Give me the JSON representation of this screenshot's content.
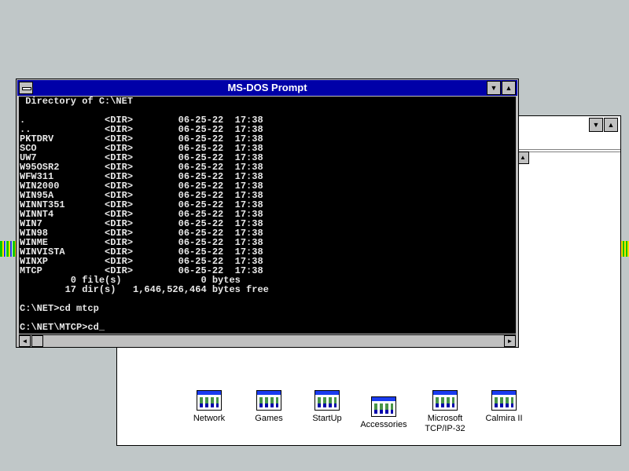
{
  "dos_window": {
    "title": "MS-DOS Prompt",
    "lines": [
      " Directory of C:\\NET",
      "",
      ".              <DIR>        06-25-22  17:38",
      "..             <DIR>        06-25-22  17:38",
      "PKTDRV         <DIR>        06-25-22  17:38",
      "SCO            <DIR>        06-25-22  17:38",
      "UW7            <DIR>        06-25-22  17:38",
      "W95OSR2        <DIR>        06-25-22  17:38",
      "WFW311         <DIR>        06-25-22  17:38",
      "WIN2000        <DIR>        06-25-22  17:38",
      "WIN95A         <DIR>        06-25-22  17:38",
      "WINNT351       <DIR>        06-25-22  17:38",
      "WINNT4         <DIR>        06-25-22  17:38",
      "WIN7           <DIR>        06-25-22  17:38",
      "WIN98          <DIR>        06-25-22  17:38",
      "WINME          <DIR>        06-25-22  17:38",
      "WINVISTA       <DIR>        06-25-22  17:38",
      "WINXP          <DIR>        06-25-22  17:38",
      "MTCP           <DIR>        06-25-22  17:38",
      "         0 file(s)              0 bytes",
      "        17 dir(s)   1,646,526,464 bytes free",
      "",
      "C:\\NET>cd mtcp",
      "",
      "C:\\NET\\MTCP>cd_"
    ]
  },
  "program_group": {
    "icons": [
      {
        "label": "Network"
      },
      {
        "label": "Games"
      },
      {
        "label": "StartUp"
      },
      {
        "label": "Accessories"
      },
      {
        "label": "Microsoft\nTCP/IP-32"
      },
      {
        "label": "Calmira II"
      }
    ]
  },
  "colors": {
    "desktop": "#c0c7c8",
    "active_title": "#0000a8",
    "console_bg": "#000000",
    "console_fg": "#e8e8e8"
  }
}
